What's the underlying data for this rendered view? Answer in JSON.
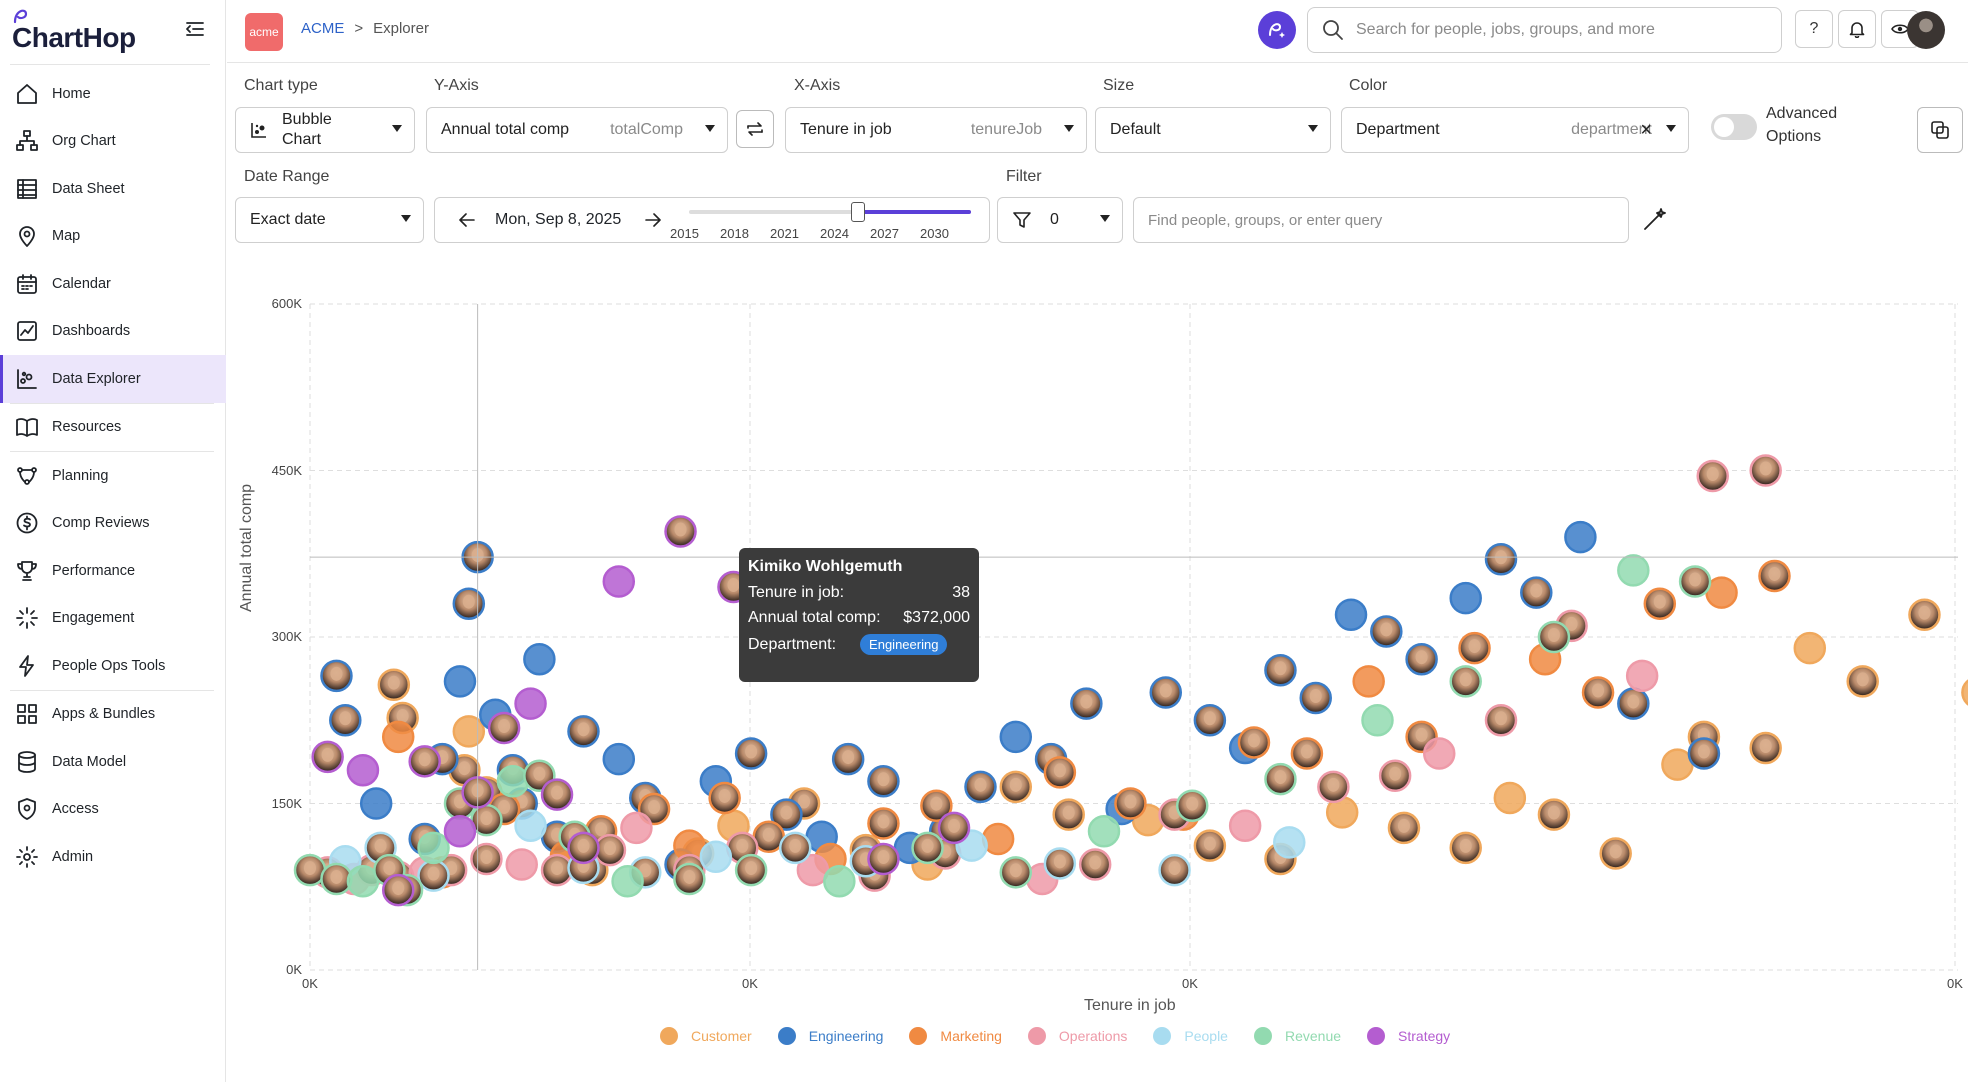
{
  "app": {
    "name": "ChartHop"
  },
  "sidebar": {
    "items": [
      {
        "label": "Home",
        "icon": "home-icon"
      },
      {
        "label": "Org Chart",
        "icon": "org-chart-icon"
      },
      {
        "label": "Data Sheet",
        "icon": "data-sheet-icon"
      },
      {
        "label": "Map",
        "icon": "map-pin-icon"
      },
      {
        "label": "Calendar",
        "icon": "calendar-icon"
      },
      {
        "label": "Dashboards",
        "icon": "dashboards-icon"
      },
      {
        "label": "Data Explorer",
        "icon": "data-explorer-icon",
        "active": true
      },
      {
        "label": "Resources",
        "icon": "book-icon"
      },
      {
        "label": "Planning",
        "icon": "planning-icon"
      },
      {
        "label": "Comp Reviews",
        "icon": "dollar-icon"
      },
      {
        "label": "Performance",
        "icon": "trophy-icon"
      },
      {
        "label": "Engagement",
        "icon": "engagement-icon"
      },
      {
        "label": "People Ops Tools",
        "icon": "bolt-icon"
      },
      {
        "label": "Apps & Bundles",
        "icon": "apps-icon"
      },
      {
        "label": "Data Model",
        "icon": "database-icon"
      },
      {
        "label": "Access",
        "icon": "shield-icon"
      },
      {
        "label": "Admin",
        "icon": "gear-icon"
      }
    ]
  },
  "header": {
    "org_badge": "acme",
    "breadcrumb_root": "ACME",
    "breadcrumb_sep": ">",
    "breadcrumb_current": "Explorer",
    "search_placeholder": "Search for people, jobs, groups, and more",
    "help_label": "?"
  },
  "controls": {
    "chart_type": {
      "label": "Chart type",
      "value": "Bubble Chart"
    },
    "y_axis": {
      "label": "Y-Axis",
      "value": "Annual total comp",
      "field": "totalComp"
    },
    "x_axis": {
      "label": "X-Axis",
      "value": "Tenure in job",
      "field": "tenureJob"
    },
    "size": {
      "label": "Size",
      "value": "Default"
    },
    "color": {
      "label": "Color",
      "value": "Department",
      "field": "department",
      "clear": "×"
    },
    "advanced_options": "Advanced Options",
    "advanced_enabled": false,
    "date_range": {
      "label": "Date Range",
      "value": "Exact date"
    },
    "date": {
      "value": "Mon, Sep 8, 2025",
      "years": [
        "2015",
        "2018",
        "2021",
        "2024",
        "2027",
        "2030"
      ],
      "slider_position": 0.6
    },
    "filter": {
      "label": "Filter",
      "count": "0"
    },
    "query_placeholder": "Find people, groups, or enter query"
  },
  "tooltip": {
    "name": "Kimiko Wohlgemuth",
    "tenure_label": "Tenure in job:",
    "tenure_value": "38",
    "comp_label": "Annual total comp:",
    "comp_value": "$372,000",
    "dept_label": "Department:",
    "dept_value": "Engineering"
  },
  "chart_data": {
    "type": "scatter",
    "xlabel": "Tenure in job",
    "ylabel": "Annual total comp",
    "y_ticks": [
      "600K",
      "450K",
      "300K",
      "150K",
      "0K"
    ],
    "x_ticks": [
      "0K",
      "0K",
      "0K",
      "0K"
    ],
    "ylim": [
      0,
      600000
    ],
    "crosshair": {
      "x": 38,
      "y": 372000
    },
    "legend": [
      {
        "name": "Customer",
        "color": "#f0a85c"
      },
      {
        "name": "Engineering",
        "color": "#3b7dc8"
      },
      {
        "name": "Marketing",
        "color": "#f08a42"
      },
      {
        "name": "Operations",
        "color": "#ee9aa8"
      },
      {
        "name": "People",
        "color": "#a8dcf0"
      },
      {
        "name": "Revenue",
        "color": "#92dab0"
      },
      {
        "name": "Strategy",
        "color": "#b45dd0"
      }
    ],
    "series": [
      {
        "name": "Customer",
        "points": [
          [
            19,
            257000
          ],
          [
            21,
            227000
          ],
          [
            36,
            215000
          ],
          [
            35,
            180000
          ],
          [
            40,
            160000
          ],
          [
            58,
            110000
          ],
          [
            64,
            90000
          ],
          [
            88,
            105000
          ],
          [
            96,
            130000
          ],
          [
            112,
            150000
          ],
          [
            126,
            108000
          ],
          [
            140,
            95000
          ],
          [
            160,
            165000
          ],
          [
            172,
            140000
          ],
          [
            190,
            135000
          ],
          [
            204,
            112000
          ],
          [
            220,
            100000
          ],
          [
            234,
            142000
          ],
          [
            248,
            128000
          ],
          [
            262,
            110000
          ],
          [
            272,
            155000
          ],
          [
            282,
            140000
          ],
          [
            296,
            105000
          ],
          [
            310,
            185000
          ],
          [
            316,
            210000
          ],
          [
            330,
            200000
          ],
          [
            340,
            290000
          ],
          [
            352,
            260000
          ],
          [
            366,
            320000
          ],
          [
            378,
            250000
          ]
        ]
      },
      {
        "name": "Engineering",
        "points": [
          [
            6,
            265000
          ],
          [
            8,
            225000
          ],
          [
            15,
            150000
          ],
          [
            26,
            118000
          ],
          [
            30,
            190000
          ],
          [
            34,
            260000
          ],
          [
            36,
            330000
          ],
          [
            38,
            372000
          ],
          [
            42,
            230000
          ],
          [
            46,
            180000
          ],
          [
            48,
            150000
          ],
          [
            52,
            280000
          ],
          [
            56,
            120000
          ],
          [
            62,
            215000
          ],
          [
            70,
            190000
          ],
          [
            76,
            155000
          ],
          [
            84,
            95000
          ],
          [
            92,
            170000
          ],
          [
            100,
            195000
          ],
          [
            108,
            140000
          ],
          [
            116,
            120000
          ],
          [
            122,
            190000
          ],
          [
            130,
            170000
          ],
          [
            136,
            110000
          ],
          [
            144,
            125000
          ],
          [
            152,
            165000
          ],
          [
            160,
            210000
          ],
          [
            168,
            190000
          ],
          [
            176,
            240000
          ],
          [
            184,
            145000
          ],
          [
            194,
            250000
          ],
          [
            204,
            225000
          ],
          [
            212,
            200000
          ],
          [
            220,
            270000
          ],
          [
            228,
            245000
          ],
          [
            236,
            320000
          ],
          [
            244,
            305000
          ],
          [
            252,
            280000
          ],
          [
            262,
            335000
          ],
          [
            270,
            370000
          ],
          [
            278,
            340000
          ],
          [
            288,
            390000
          ],
          [
            300,
            240000
          ],
          [
            316,
            195000
          ]
        ]
      },
      {
        "name": "Marketing",
        "points": [
          [
            20,
            210000
          ],
          [
            30,
            88000
          ],
          [
            44,
            145000
          ],
          [
            58,
            102000
          ],
          [
            66,
            125000
          ],
          [
            78,
            145000
          ],
          [
            86,
            112000
          ],
          [
            94,
            155000
          ],
          [
            104,
            120000
          ],
          [
            118,
            100000
          ],
          [
            130,
            132000
          ],
          [
            142,
            148000
          ],
          [
            156,
            118000
          ],
          [
            170,
            178000
          ],
          [
            186,
            150000
          ],
          [
            198,
            140000
          ],
          [
            214,
            205000
          ],
          [
            226,
            195000
          ],
          [
            240,
            260000
          ],
          [
            252,
            210000
          ],
          [
            264,
            290000
          ],
          [
            280,
            280000
          ],
          [
            292,
            250000
          ],
          [
            306,
            330000
          ],
          [
            320,
            340000
          ],
          [
            332,
            355000
          ]
        ]
      },
      {
        "name": "Operations",
        "points": [
          [
            4,
            88000
          ],
          [
            10,
            82000
          ],
          [
            14,
            90000
          ],
          [
            20,
            84000
          ],
          [
            26,
            88000
          ],
          [
            32,
            90000
          ],
          [
            40,
            100000
          ],
          [
            48,
            95000
          ],
          [
            56,
            90000
          ],
          [
            68,
            108000
          ],
          [
            74,
            128000
          ],
          [
            86,
            90000
          ],
          [
            98,
            110000
          ],
          [
            114,
            90000
          ],
          [
            128,
            85000
          ],
          [
            144,
            105000
          ],
          [
            166,
            82000
          ],
          [
            178,
            95000
          ],
          [
            196,
            140000
          ],
          [
            212,
            130000
          ],
          [
            232,
            165000
          ],
          [
            246,
            175000
          ],
          [
            256,
            195000
          ],
          [
            270,
            225000
          ],
          [
            286,
            310000
          ],
          [
            302,
            265000
          ],
          [
            318,
            445000
          ],
          [
            330,
            450000
          ]
        ]
      },
      {
        "name": "People",
        "points": [
          [
            8,
            98000
          ],
          [
            16,
            110000
          ],
          [
            28,
            85000
          ],
          [
            50,
            130000
          ],
          [
            62,
            92000
          ],
          [
            76,
            88000
          ],
          [
            92,
            102000
          ],
          [
            110,
            110000
          ],
          [
            126,
            98000
          ],
          [
            150,
            112000
          ],
          [
            170,
            96000
          ],
          [
            196,
            90000
          ],
          [
            222,
            115000
          ]
        ]
      },
      {
        "name": "Revenue",
        "points": [
          [
            0,
            90000
          ],
          [
            6,
            82000
          ],
          [
            12,
            80000
          ],
          [
            18,
            90000
          ],
          [
            22,
            72000
          ],
          [
            28,
            110000
          ],
          [
            34,
            150000
          ],
          [
            40,
            135000
          ],
          [
            46,
            170000
          ],
          [
            52,
            175000
          ],
          [
            60,
            120000
          ],
          [
            72,
            80000
          ],
          [
            86,
            82000
          ],
          [
            100,
            90000
          ],
          [
            120,
            80000
          ],
          [
            140,
            110000
          ],
          [
            160,
            88000
          ],
          [
            180,
            125000
          ],
          [
            200,
            148000
          ],
          [
            220,
            172000
          ],
          [
            242,
            225000
          ],
          [
            262,
            260000
          ],
          [
            282,
            300000
          ],
          [
            300,
            360000
          ],
          [
            314,
            350000
          ]
        ]
      },
      {
        "name": "Strategy",
        "points": [
          [
            4,
            192000
          ],
          [
            12,
            180000
          ],
          [
            20,
            72000
          ],
          [
            26,
            188000
          ],
          [
            34,
            125000
          ],
          [
            38,
            160000
          ],
          [
            44,
            218000
          ],
          [
            50,
            240000
          ],
          [
            56,
            158000
          ],
          [
            62,
            110000
          ],
          [
            70,
            350000
          ],
          [
            84,
            395000
          ],
          [
            96,
            345000
          ],
          [
            108,
            330000
          ],
          [
            130,
            100000
          ],
          [
            146,
            128000
          ]
        ]
      }
    ]
  }
}
